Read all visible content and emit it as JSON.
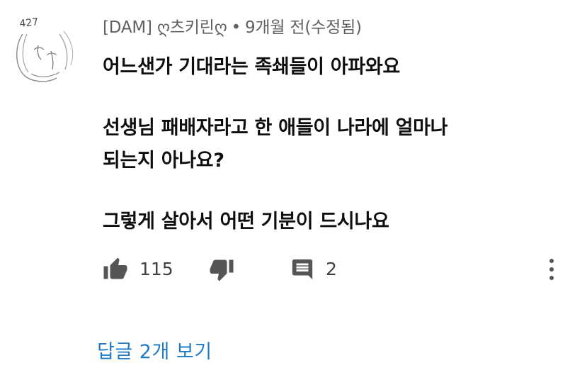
{
  "comment": {
    "author": "[DAM] ღ츠키린ღ",
    "separator": "•",
    "timestamp": "9개월 전(수정됨)",
    "avatar_icon": "hand-drawn-sketch-avatar",
    "avatar_text": "427",
    "lines": [
      "어느샌가 기대라는 족쇄들이 아파와요",
      "선생님 패배자라고 한 애들이 나라에 얼마나",
      "되는지 아나요?",
      "그렇게 살아서 어떤 기분이 드시나요"
    ]
  },
  "actions": {
    "like_icon": "thumbs-up-icon",
    "like_count": "115",
    "dislike_icon": "thumbs-down-icon",
    "reply_icon": "comment-icon",
    "reply_count": "2",
    "more_icon": "more-vertical-icon"
  },
  "view_replies": {
    "label": "답글 2개 보기",
    "color": "#1f7ac9"
  }
}
